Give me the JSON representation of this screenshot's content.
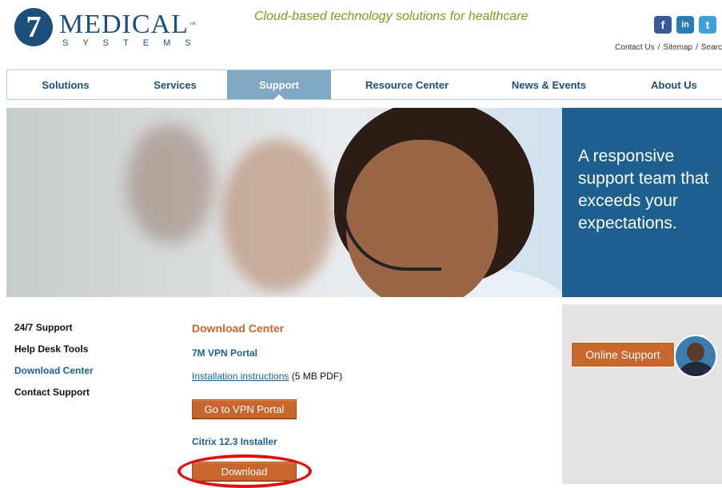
{
  "header": {
    "logo": {
      "numeral": "7",
      "word": "MEDICAL",
      "tm": "™",
      "sub": "SYSTEMS"
    },
    "tagline": "Cloud-based technology solutions for healthcare",
    "social": {
      "facebook": "f",
      "linkedin": "in",
      "twitter": "t"
    },
    "links": {
      "contact": "Contact Us",
      "sitemap": "Sitemap",
      "search": "Searc",
      "separator": "/"
    }
  },
  "nav": {
    "items": [
      {
        "label": "Solutions"
      },
      {
        "label": "Services"
      },
      {
        "label": "Support",
        "active": true
      },
      {
        "label": "Resource Center"
      },
      {
        "label": "News & Events"
      },
      {
        "label": "About Us"
      }
    ]
  },
  "hero": {
    "text": "A responsive support team that exceeds your expectations."
  },
  "subnav": {
    "items": [
      {
        "label": "24/7 Support"
      },
      {
        "label": "Help Desk Tools"
      },
      {
        "label": "Download Center",
        "current": true
      },
      {
        "label": "Contact Support"
      }
    ]
  },
  "content": {
    "heading": "Download Center",
    "vpn": {
      "title": "7M VPN Portal",
      "link": "Installation instructions",
      "link_note": "(5 MB PDF)",
      "button": "Go to VPN Portal"
    },
    "citrix": {
      "title": "Citrix 12.3 Installer",
      "button": "Download"
    }
  },
  "sidebar": {
    "online_support": "Online Support"
  },
  "colors": {
    "brand_blue": "#1d4f7c",
    "accent_orange": "#c8662e",
    "tagline_green": "#7a9a1e",
    "highlight_red": "#e01010"
  }
}
